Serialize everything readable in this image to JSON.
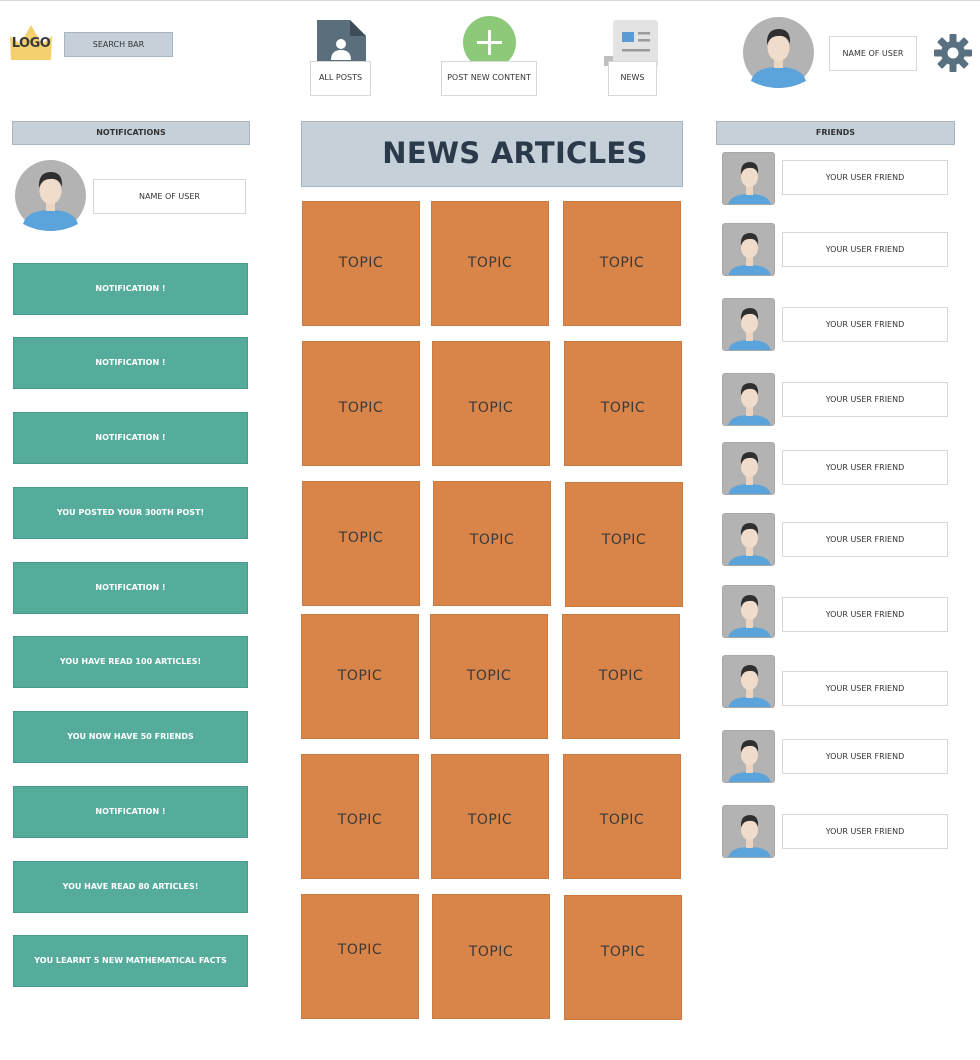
{
  "header": {
    "logo_text": "LOGO",
    "search_placeholder": "SEARCH BAR",
    "all_posts_label": "ALL POSTS",
    "post_new_label": "POST NEW CONTENT",
    "news_label": "NEWS",
    "user_name": "NAME OF USER"
  },
  "notifications_panel": {
    "title": "NOTIFICATIONS",
    "user_name": "NAME OF USER",
    "items": [
      "NOTIFICATION !",
      "NOTIFICATION !",
      "NOTIFICATION !",
      "YOU POSTED YOUR 300TH POST!",
      "NOTIFICATION !",
      "YOU HAVE READ 100 ARTICLES!",
      "YOU NOW HAVE 50 FRIENDS",
      "NOTIFICATION !",
      "YOU HAVE READ 80 ARTICLES!",
      "YOU LEARNT 5 NEW MATHEMATICAL FACTS"
    ]
  },
  "news": {
    "title": "NEWS ARTICLES",
    "topics": [
      "TOPIC",
      "TOPIC",
      "TOPIC",
      "TOPIC",
      "TOPIC",
      "TOPIC",
      "TOPIC",
      "TOPIC",
      "TOPIC",
      "TOPIC",
      "TOPIC",
      "TOPIC",
      "TOPIC",
      "TOPIC",
      "TOPIC",
      "TOPIC",
      "TOPIC",
      "TOPIC"
    ]
  },
  "friends_panel": {
    "title": "FRIENDS",
    "items": [
      "YOUR USER FRIEND",
      "YOUR USER FRIEND",
      "YOUR USER FRIEND",
      "YOUR USER FRIEND",
      "YOUR USER FRIEND",
      "YOUR USER FRIEND",
      "YOUR USER FRIEND",
      "YOUR USER FRIEND",
      "YOUR USER FRIEND",
      "YOUR USER FRIEND"
    ]
  },
  "colors": {
    "notification": "#55ac9b",
    "topic": "#d9854a",
    "header_panel": "#c6d0d9",
    "post_button": "#8cc978",
    "avatar_shirt": "#5ba3db"
  },
  "icons": [
    "logo-crown-icon",
    "document-user-icon",
    "plus-icon",
    "news-article-icon",
    "user-avatar-icon",
    "gear-icon"
  ]
}
